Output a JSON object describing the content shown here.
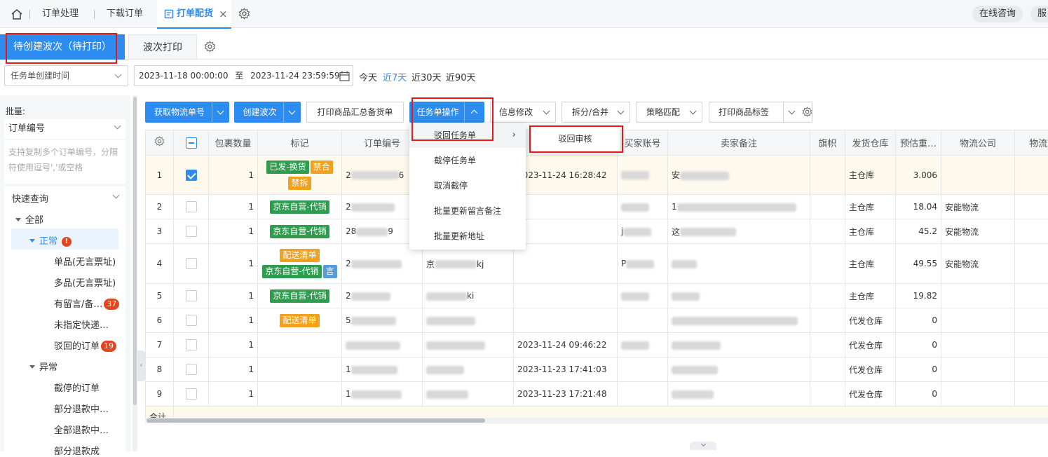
{
  "nav": {
    "tabs": [
      "订单处理",
      "下载订单",
      "打单配货"
    ],
    "active_tab": "打单配货",
    "close_glyph": "×",
    "online_consult": "在线咨询",
    "service": "服"
  },
  "subtabs": {
    "active": "待创建波次（待打印）",
    "other": "波次打印"
  },
  "filter": {
    "time_type": "任务单创建时间",
    "start": "2023-11-18 00:00:00",
    "to": "至",
    "end": "2023-11-24 23:59:59",
    "quick": [
      "今天",
      "近7天",
      "近30天",
      "近90天"
    ]
  },
  "sidebar": {
    "batch_label": "批量:",
    "batch_field": "订单编号",
    "batch_placeholder": "支持复制多个订单编号，分隔符使用逗号','或空格",
    "quick_query": "快速查询",
    "all": "全部",
    "normal": "正常",
    "alert_glyph": "!",
    "items": [
      {
        "label": "单品(无言票址)",
        "badge": ""
      },
      {
        "label": "多品(无言票址)",
        "badge": ""
      },
      {
        "label": "有留言/备…",
        "badge": "37"
      },
      {
        "label": "未指定快递…",
        "badge": ""
      },
      {
        "label": "驳回的订单",
        "badge": "19"
      }
    ],
    "abnormal": "异常",
    "abnormal_items": [
      "截停的订单",
      "部分退款中…",
      "全部退款中…",
      "部分退款成"
    ]
  },
  "toolbar": {
    "get_waybill": "获取物流单号",
    "create_batch": "创建波次",
    "print_summary": "打印商品汇总备货单",
    "task_ops": "任务单操作",
    "info_edit": "信息修改",
    "split_merge": "拆分/合并",
    "strategy": "策略匹配",
    "print_label": "打印商品标签"
  },
  "menu": {
    "items": [
      "驳回任务单",
      "截停任务单",
      "取消截停",
      "批量更新留言备注",
      "批量更新地址"
    ],
    "submenu_item": "驳回审核"
  },
  "table": {
    "headers": [
      "包裹数量",
      "标记",
      "订单编号",
      "",
      "",
      "买家账号",
      "卖家备注",
      "旗帜",
      "发货仓库",
      "预估重…",
      "物流公司",
      "物流服"
    ],
    "rows": [
      {
        "idx": "1",
        "checked": true,
        "qty": "1",
        "tags": [
          {
            "t": "已发-换货",
            "c": "g"
          },
          {
            "t": "禁合",
            "c": "o"
          },
          {
            "t": "禁拆",
            "c": "o"
          }
        ],
        "order": "2",
        "order_tail": "6",
        "col4": "",
        "time": "2023-11-24 16:28:42",
        "buyer": "",
        "note": "安",
        "wh": "主仓库",
        "weight": "3.006",
        "logistics": ""
      },
      {
        "idx": "2",
        "checked": false,
        "qty": "1",
        "tags": [
          {
            "t": "京东自营-代销",
            "c": "g"
          }
        ],
        "order": "2",
        "order_tail": "",
        "col4": "",
        "time": "",
        "buyer": "",
        "note": "1",
        "wh": "主仓库",
        "weight": "18.04",
        "logistics": "安能物流"
      },
      {
        "idx": "3",
        "checked": false,
        "qty": "1",
        "tags": [
          {
            "t": "京东自营-代销",
            "c": "g"
          }
        ],
        "order": "28",
        "order_tail": "9",
        "col4": "",
        "time": "",
        "buyer": "j",
        "note": "这",
        "wh": "主仓库",
        "weight": "45.2",
        "logistics": "安能物流"
      },
      {
        "idx": "4",
        "checked": false,
        "qty": "1",
        "tags": [
          {
            "t": "配送清单",
            "c": "o"
          },
          {
            "t": "京东自营-代销",
            "c": "g"
          },
          {
            "t": "言",
            "c": "b"
          }
        ],
        "order": "2",
        "order_tail": "",
        "col4": "京",
        "col4_tail": "kj",
        "time": "",
        "buyer": "P",
        "note": "",
        "wh": "主仓库",
        "weight": "49.55",
        "logistics": "安能物流"
      },
      {
        "idx": "5",
        "checked": false,
        "qty": "1",
        "tags": [
          {
            "t": "京东自营-代销",
            "c": "g"
          }
        ],
        "order": "2",
        "order_tail": "",
        "col4": "",
        "col4_tail": "ki",
        "time": "",
        "buyer": "",
        "note": "",
        "wh": "主仓库",
        "weight": "19.82",
        "logistics": ""
      },
      {
        "idx": "6",
        "checked": false,
        "qty": "1",
        "tags": [
          {
            "t": "配送清单",
            "c": "o"
          }
        ],
        "order": "5",
        "order_tail": "",
        "col4": "",
        "time": "",
        "buyer": "",
        "note": "",
        "wh": "代发仓库",
        "weight": "0",
        "logistics": ""
      },
      {
        "idx": "7",
        "checked": false,
        "qty": "1",
        "tags": [],
        "order": "",
        "order_tail": "",
        "col4": "",
        "time": "2023-11-24 09:46:22",
        "buyer": "",
        "note": "",
        "wh": "代发仓库",
        "weight": "0",
        "logistics": ""
      },
      {
        "idx": "8",
        "checked": false,
        "qty": "1",
        "tags": [],
        "order": "1",
        "order_tail": "",
        "col4": "",
        "time": "2023-11-23 17:41:03",
        "buyer": "",
        "note": "",
        "wh": "代发仓库",
        "weight": "0",
        "logistics": ""
      },
      {
        "idx": "9",
        "checked": false,
        "qty": "1",
        "tags": [],
        "order": "1",
        "order_tail": "",
        "col4": "",
        "time": "2023-11-23 17:21:48",
        "buyer": "",
        "note": "",
        "wh": "代发仓库",
        "weight": "0",
        "logistics": ""
      }
    ],
    "total_label": "合计"
  }
}
